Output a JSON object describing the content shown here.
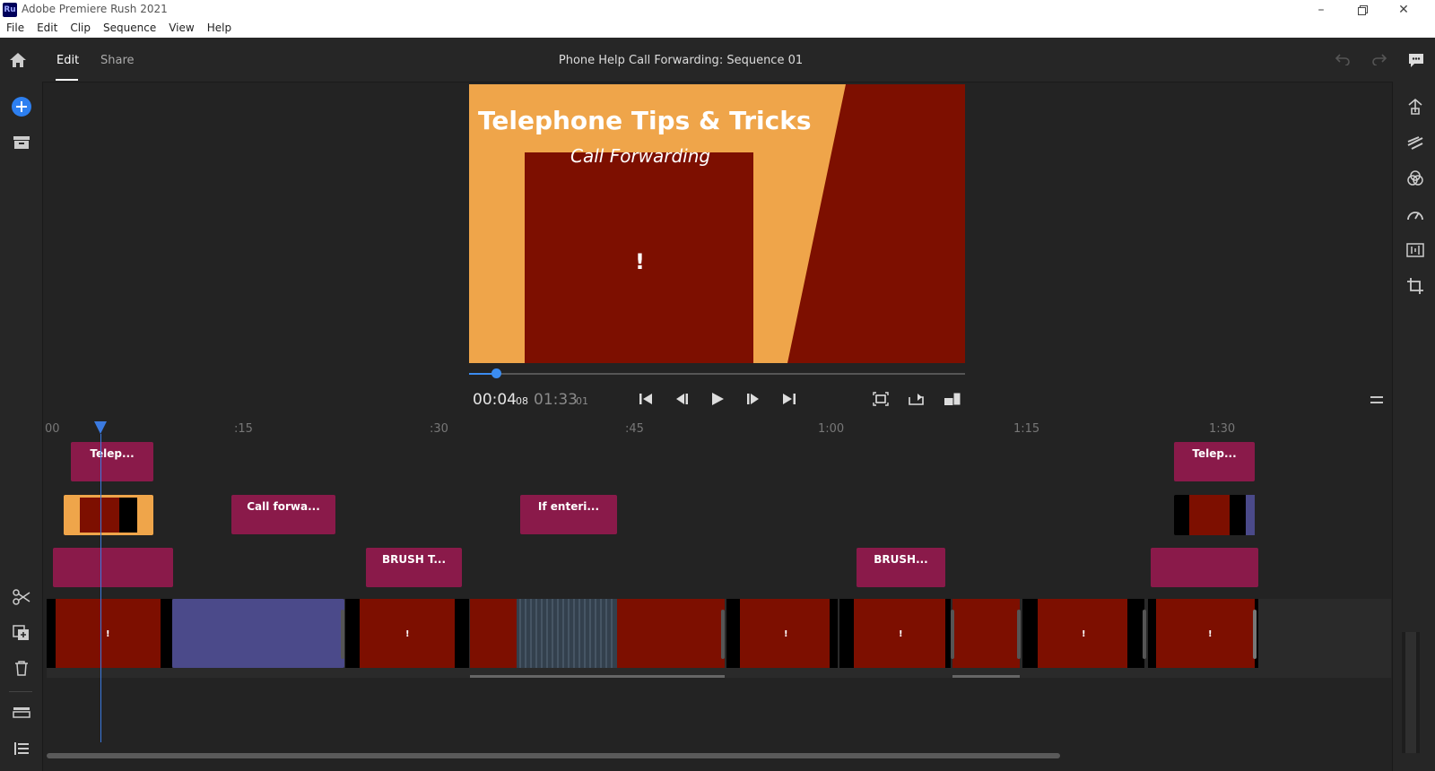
{
  "window": {
    "app_icon": "Ru",
    "title": "Adobe Premiere Rush 2021",
    "controls": [
      "minimize-icon",
      "restore-icon",
      "close-icon"
    ]
  },
  "menu": [
    "File",
    "Edit",
    "Clip",
    "Sequence",
    "View",
    "Help"
  ],
  "header": {
    "tabs": [
      {
        "label": "Edit",
        "active": true
      },
      {
        "label": "Share",
        "active": false
      }
    ],
    "sequence_title": "Phone Help Call Forwarding: Sequence 01"
  },
  "preview": {
    "title_text": "Telephone Tips & Tricks",
    "subtitle_text": "Call Forwarding",
    "center_mark": "!",
    "colors": {
      "orange": "#efa54a",
      "dark_red": "#7d0f00"
    }
  },
  "playback": {
    "current_time": "00:04",
    "current_frames": "08",
    "total_time": "01:33",
    "total_frames": "01",
    "progress_fraction": 0.047
  },
  "timeline": {
    "ruler_ticks": [
      "00",
      ":15",
      ":30",
      ":45",
      "1:00",
      "1:15",
      "1:30"
    ],
    "title_track_1": [
      "Telep...",
      "Telep..."
    ],
    "title_track_2": [
      "Call forwa...",
      "If enteri..."
    ],
    "title_track_3": [
      "",
      "BRUSH T...",
      "BRUSH...",
      ""
    ],
    "clip_mark": "!",
    "accent": "#3b7ae0",
    "title_clip_color": "#8a1a4a",
    "video_color": "#7d0f00",
    "audio_color": "#4b4a8a"
  }
}
